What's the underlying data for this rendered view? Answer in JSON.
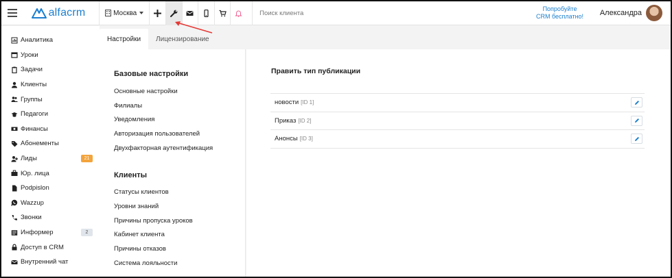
{
  "topbar": {
    "logo_text": "alfacrm",
    "city": "Москва",
    "search_placeholder": "Поиск клиента",
    "try_line1": "Попробуйте",
    "try_line2": "CRM бесплатно!",
    "user_name": "Александра",
    "icons": [
      "menu-icon",
      "building-icon",
      "plus-icon",
      "wrench-icon",
      "mail-icon",
      "phone-icon",
      "cart-icon",
      "bell-icon"
    ]
  },
  "sidebar": {
    "items": [
      {
        "label": "Аналитика",
        "icon": "analytics-icon"
      },
      {
        "label": "Уроки",
        "icon": "calendar-icon"
      },
      {
        "label": "Задачи",
        "icon": "clipboard-icon"
      },
      {
        "label": "Клиенты",
        "icon": "user-icon"
      },
      {
        "label": "Группы",
        "icon": "users-icon"
      },
      {
        "label": "Педагоги",
        "icon": "graduation-cap-icon"
      },
      {
        "label": "Финансы",
        "icon": "money-icon"
      },
      {
        "label": "Абонементы",
        "icon": "tag-icon"
      },
      {
        "label": "Лиды",
        "icon": "user-plus-icon",
        "badge": "21"
      },
      {
        "label": "Юр. лица",
        "icon": "briefcase-icon"
      },
      {
        "label": "Podpislon",
        "icon": "file-icon"
      },
      {
        "label": "Wazzup",
        "icon": "whatsapp-icon"
      },
      {
        "label": "Звонки",
        "icon": "phone-call-icon"
      },
      {
        "label": "Информер",
        "icon": "newspaper-icon",
        "badge": "2"
      },
      {
        "label": "Доступ в CRM",
        "icon": "lock-icon"
      },
      {
        "label": "Внутренний чат",
        "icon": "envelope-icon"
      }
    ]
  },
  "tabs": [
    {
      "label": "Настройки",
      "active": true
    },
    {
      "label": "Лицензирование",
      "active": false
    }
  ],
  "settings": {
    "basic_title": "Базовые настройки",
    "basic_links": [
      "Основные настройки",
      "Филиалы",
      "Уведомления",
      "Авторизация пользователей",
      "Двухфакторная аутентификация"
    ],
    "clients_title": "Клиенты",
    "clients_links": [
      "Статусы клиентов",
      "Уровни знаний",
      "Причины пропуска уроков",
      "Кабинет клиента",
      "Причины отказов",
      "Система лояльности"
    ]
  },
  "main": {
    "title": "Править тип публикации",
    "rows": [
      {
        "name": "новости",
        "id": "[ID 1]"
      },
      {
        "name": "Приказ",
        "id": "[ID 2]"
      },
      {
        "name": "Анонсы",
        "id": "[ID 3]"
      }
    ]
  },
  "colors": {
    "brand": "#1b7fcf",
    "badge_orange": "#f3a43c",
    "badge_gray": "#dfe5ea",
    "annotation_arrow": "#e53935"
  }
}
